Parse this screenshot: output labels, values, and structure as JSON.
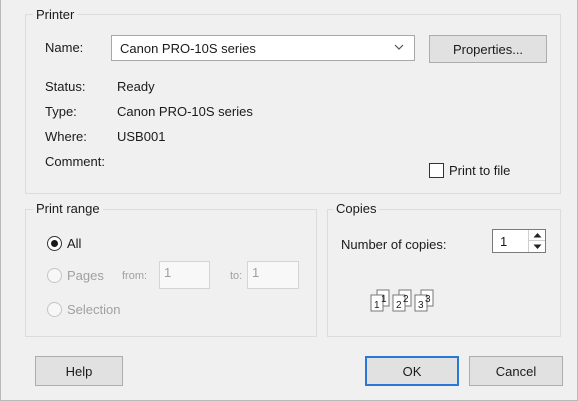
{
  "printer": {
    "group_title": "Printer",
    "name_label": "Name:",
    "name_value": "Canon PRO-10S series",
    "properties_label": "Properties...",
    "status_label": "Status:",
    "status_value": "Ready",
    "type_label": "Type:",
    "type_value": "Canon PRO-10S series",
    "where_label": "Where:",
    "where_value": "USB001",
    "comment_label": "Comment:",
    "print_to_file_label": "Print to file",
    "print_to_file_checked": false
  },
  "print_range": {
    "group_title": "Print range",
    "all_label": "All",
    "all_selected": true,
    "pages_label": "Pages",
    "from_label": "from:",
    "from_value": "1",
    "to_label": "to:",
    "to_value": "1",
    "selection_label": "Selection"
  },
  "copies": {
    "group_title": "Copies",
    "number_label": "Number of copies:",
    "number_value": "1",
    "collate_icon": "collate-pages-icon"
  },
  "footer": {
    "help_label": "Help",
    "ok_label": "OK",
    "cancel_label": "Cancel"
  },
  "colors": {
    "dialog_bg": "#f0f0f0",
    "default_button_border": "#2b79d7",
    "disabled_text": "#a0a0a0"
  }
}
